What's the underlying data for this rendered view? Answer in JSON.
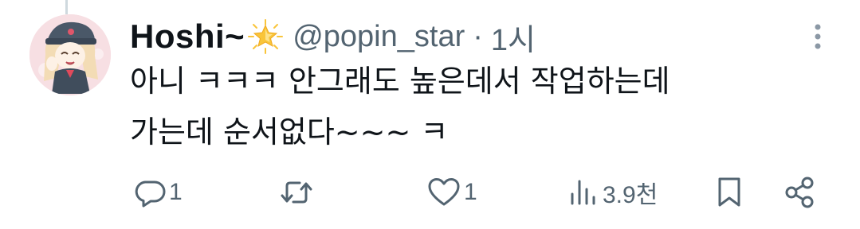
{
  "tweet": {
    "display_name": "Hoshi~",
    "handle": "@popin_star",
    "separator": "·",
    "time": "1시",
    "text_line1": "아니 ㅋㅋㅋ 안그래도 높은데서 작업하는데",
    "text_line2": "가는데 순서없다~~~ ㅋ"
  },
  "actions": {
    "reply_count": "1",
    "like_count": "1",
    "views_count": "3.9천"
  },
  "icons": {
    "badge": "sparkle-star-emoji",
    "reply": "speech-bubble-icon",
    "retweet": "retweet-icon",
    "like": "heart-icon",
    "views": "bar-chart-icon",
    "bookmark": "bookmark-icon",
    "share": "share-icon",
    "more": "vertical-ellipsis-icon"
  },
  "colors": {
    "text_primary": "#0f1419",
    "text_secondary": "#536471",
    "thread_line": "#cfd9de",
    "sparkle": "#f9c53a"
  }
}
